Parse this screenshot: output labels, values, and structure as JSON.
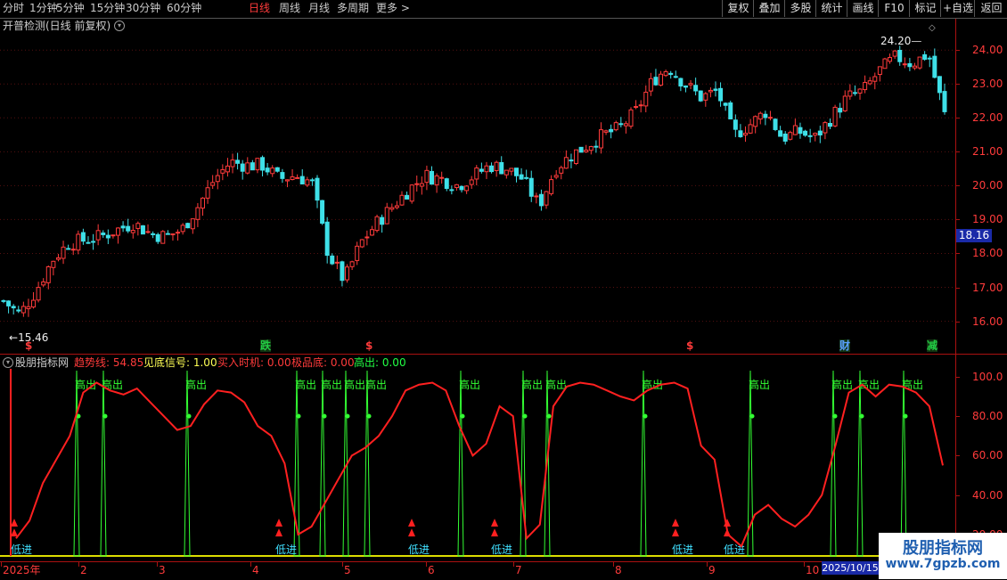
{
  "toolbar": {
    "tabs": [
      "分时",
      "1分钟",
      "5分钟",
      "15分钟",
      "30分钟",
      "60分钟",
      "日线",
      "周线",
      "月线",
      "多周期",
      "更多 >"
    ],
    "active_tab": "日线",
    "right_buttons": [
      "复权",
      "叠加",
      "多股",
      "统计",
      "画线",
      "F10",
      "标记",
      "+自选",
      "返回"
    ]
  },
  "main_panel": {
    "title": "开普检测(日线 前复权)",
    "high_label": "24.20",
    "low_label": "15.46",
    "current_price_badge": "18.16",
    "y_ticks": [
      "24.00",
      "23.00",
      "22.00",
      "21.00",
      "20.00",
      "19.00",
      "18.00",
      "17.00",
      "16.00"
    ],
    "event_markers": [
      {
        "text": "$",
        "color": "#ff3b3b"
      },
      {
        "text": "跌",
        "color": "#22cc44"
      },
      {
        "text": "$",
        "color": "#ff3b3b"
      },
      {
        "text": "$",
        "color": "#ff3b3b"
      },
      {
        "text": "财",
        "color": "#5aa0ff"
      },
      {
        "text": "减",
        "color": "#22cc44"
      }
    ],
    "colors": {
      "up": "#ff3b3b",
      "down": "#3ee0e8"
    }
  },
  "indicator_panel": {
    "name": "股朋指标网",
    "params": [
      {
        "label": "趋势线: 54.85",
        "color": "#ff3b3b"
      },
      {
        "label": "见底信号: 1.00",
        "color": "#ffff55"
      },
      {
        "label": "买入时机: 0.00",
        "color": "#ff3b3b"
      },
      {
        "label": "极品底: 0.00",
        "color": "#ff3b3b"
      },
      {
        "label": "高出: 0.00",
        "color": "#22ff44"
      }
    ],
    "y_ticks": [
      "100.0",
      "80.00",
      "60.00",
      "40.00",
      "20.00"
    ],
    "signal_high_label": "高出",
    "signal_low_label": "低进",
    "colors": {
      "trend": "#ff2020",
      "high_signal": "#33ff33",
      "low_signal": "#40e0ff"
    }
  },
  "date_axis": {
    "labels": [
      "2025年",
      "2",
      "3",
      "4",
      "5",
      "6",
      "7",
      "8",
      "9",
      "10"
    ],
    "current_date": "2025/10/15"
  },
  "watermark": {
    "line1": "股朋指标网",
    "line2": "www.7gpzb.com"
  },
  "chart_data": [
    {
      "type": "candlestick",
      "title": "开普检测(日线 前复权)",
      "ylim": [
        15.2,
        24.4
      ],
      "x_range": [
        "2025-01",
        "2025-10-15"
      ],
      "annotated_high": 24.2,
      "annotated_low": 15.46,
      "last_close": 22.1,
      "close_path": [
        16.6,
        16.2,
        16.9,
        17.8,
        18.3,
        18.4,
        18.5,
        18.7,
        18.9,
        18.6,
        18.5,
        18.7,
        19.4,
        20.2,
        20.7,
        20.6,
        20.6,
        20.2,
        20.3,
        20.1,
        18.0,
        17.2,
        18.3,
        18.9,
        19.4,
        19.9,
        20.3,
        20.2,
        20.0,
        20.3,
        20.6,
        20.5,
        20.2,
        19.4,
        20.5,
        20.9,
        21.2,
        21.5,
        21.7,
        22.2,
        23.1,
        23.5,
        23.0,
        22.6,
        22.8,
        21.5,
        21.8,
        22.2,
        21.4,
        21.6,
        21.4,
        22.0,
        22.6,
        22.8,
        23.4,
        23.8,
        23.6,
        23.9,
        22.1
      ],
      "note_price": 18.16
    },
    {
      "type": "line",
      "ylim": [
        10,
        104
      ],
      "series": [
        {
          "name": "趋势线",
          "values": [
            18,
            27,
            46,
            58,
            70,
            92,
            97,
            93,
            91,
            94,
            87,
            80,
            73,
            75,
            86,
            93,
            92,
            87,
            75,
            70,
            56,
            20,
            24,
            36,
            48,
            60,
            64,
            70,
            80,
            93,
            96,
            97,
            93,
            75,
            60,
            66,
            85,
            80,
            18,
            25,
            85,
            95,
            97,
            96,
            93,
            90,
            88,
            93,
            96,
            97,
            94,
            65,
            58,
            20,
            14,
            30,
            35,
            28,
            24,
            30,
            40,
            65,
            92,
            96,
            90,
            96,
            95,
            92,
            85,
            55
          ]
        }
      ],
      "signals_high_count": 14,
      "signals_low_count": 6,
      "last_value": 54.85
    }
  ]
}
